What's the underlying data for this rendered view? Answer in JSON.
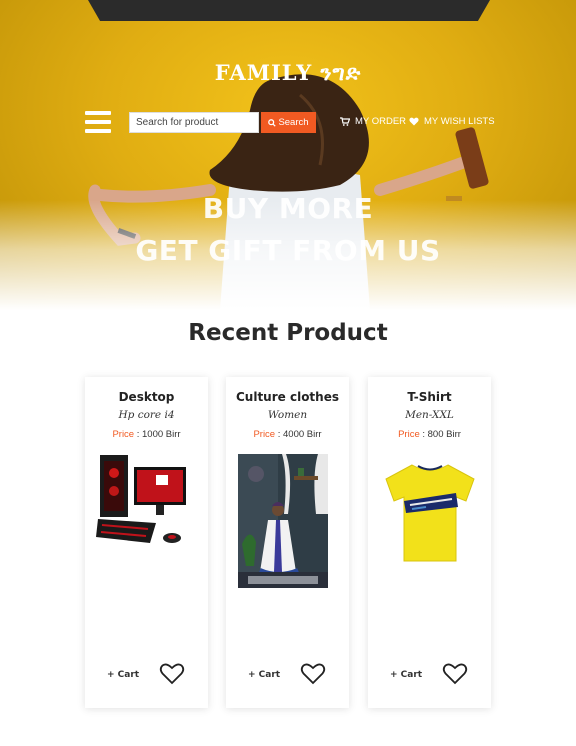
{
  "header": {
    "brand": "FAMILY ንግድ",
    "search_placeholder": "Search for product",
    "search_button": "Search",
    "my_order": "MY ORDER",
    "wish_lists": "MY WISH LISTS"
  },
  "hero": {
    "line1": "BUY MORE",
    "line2": "GET GIFT FROM US"
  },
  "section": {
    "title": "Recent Product"
  },
  "products": [
    {
      "name": "Desktop",
      "subtitle": "Hp core i4",
      "price_label": "Price",
      "price": ": 1000 Birr",
      "cart": "+ Cart",
      "image": "desktop-computer"
    },
    {
      "name": "Culture clothes",
      "subtitle": "Women",
      "price_label": "Price",
      "price": ": 4000 Birr",
      "cart": "+ Cart",
      "image": "traditional-dress"
    },
    {
      "name": "T-Shirt",
      "subtitle": "Men-XXL",
      "price_label": "Price",
      "price": ": 800 Birr",
      "cart": "+ Cart",
      "image": "yellow-tshirt"
    }
  ],
  "colors": {
    "accent": "#f15a22",
    "hero": "#e0ad12",
    "dark": "#2b2b2b"
  }
}
